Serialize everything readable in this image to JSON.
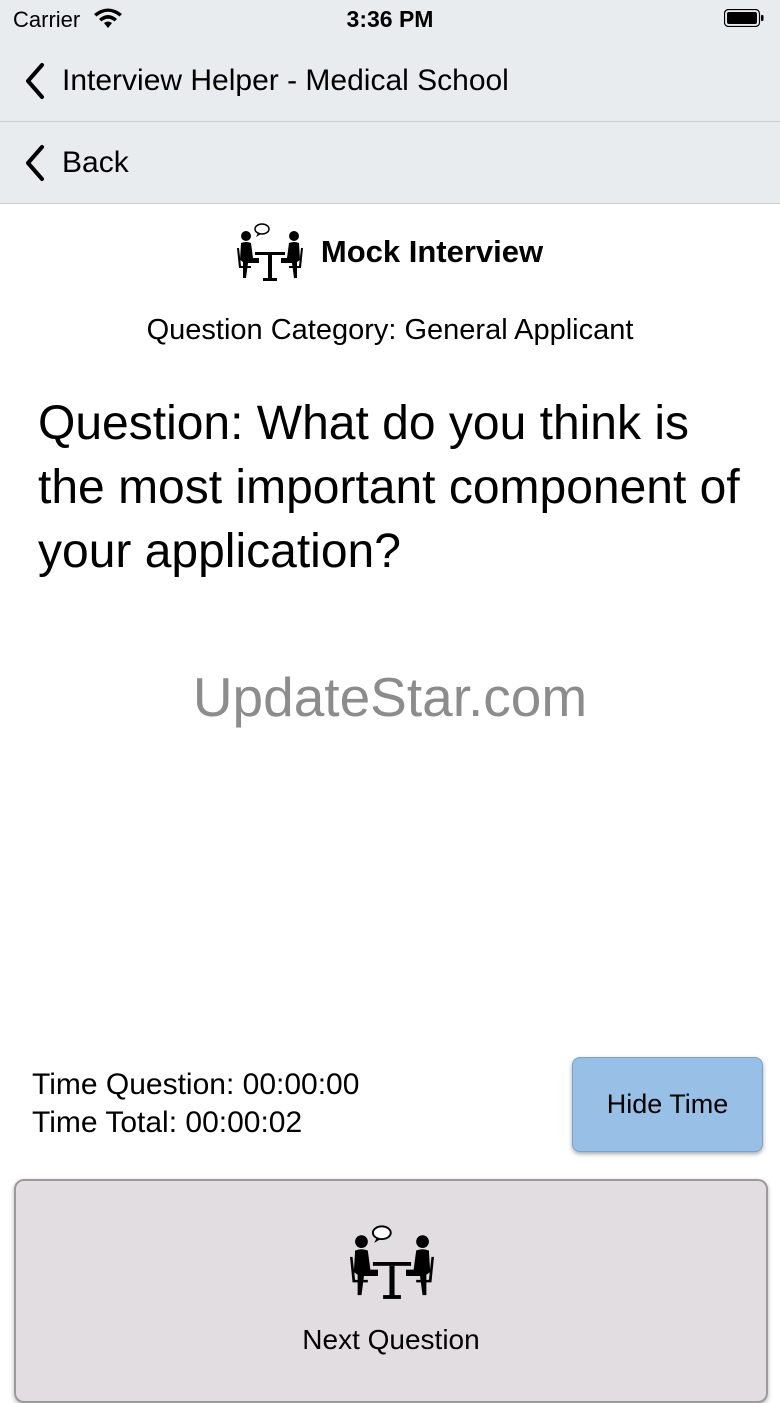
{
  "status": {
    "carrier": "Carrier",
    "time": "3:36 PM"
  },
  "nav": {
    "back_to_app": "Interview Helper - Medical School",
    "back": "Back"
  },
  "header": {
    "title": "Mock Interview",
    "icon": "interview-icon"
  },
  "category": "Question Category: General Applicant",
  "question": "Question: What do you think is the most important component of your application?",
  "watermark": "UpdateStar.com",
  "timers": {
    "question": "Time Question: 00:00:00",
    "total": "Time Total: 00:00:02"
  },
  "buttons": {
    "hide_time": "Hide Time",
    "next_question": "Next Question"
  },
  "colors": {
    "bar_bg": "#e9ecef",
    "hide_button": "#98bfe6",
    "next_button": "#e2dde1"
  }
}
